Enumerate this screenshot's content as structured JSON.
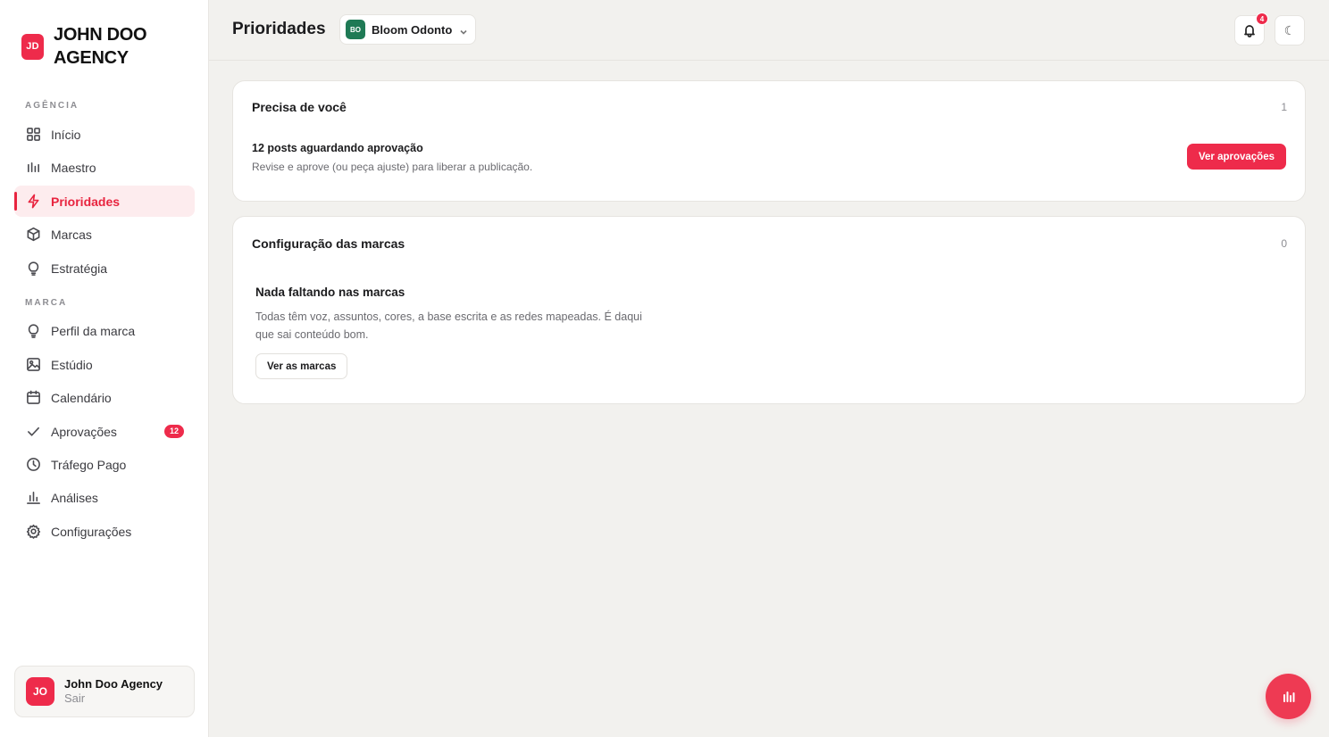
{
  "brand": {
    "logo_initials": "JD",
    "name": "JOHN DOO AGENCY"
  },
  "sidebar": {
    "sections": [
      {
        "label": "AGÊNCIA",
        "items": [
          {
            "label": "Início",
            "icon": "grid-icon"
          },
          {
            "label": "Maestro",
            "icon": "bars-icon"
          },
          {
            "label": "Prioridades",
            "icon": "bolt-icon",
            "active": true
          },
          {
            "label": "Marcas",
            "icon": "box-icon"
          },
          {
            "label": "Estratégia",
            "icon": "lightbulb-icon"
          }
        ]
      },
      {
        "label": "MARCA",
        "items": [
          {
            "label": "Perfil da marca",
            "icon": "lightbulb-icon"
          },
          {
            "label": "Estúdio",
            "icon": "image-icon"
          },
          {
            "label": "Calendário",
            "icon": "calendar-icon"
          },
          {
            "label": "Aprovações",
            "icon": "check-icon",
            "badge": "12"
          },
          {
            "label": "Tráfego Pago",
            "icon": "clock-icon"
          },
          {
            "label": "Análises",
            "icon": "chart-icon"
          },
          {
            "label": "Configurações",
            "icon": "gear-icon"
          }
        ]
      }
    ],
    "user": {
      "initials": "JO",
      "name": "John Doo Agency",
      "action": "Sair"
    }
  },
  "header": {
    "title": "Prioridades",
    "brand_selector": {
      "initials": "BO",
      "name": "Bloom Odonto"
    },
    "notifications_count": "4",
    "theme_toggle_glyph": "☾"
  },
  "cards": {
    "needs_you": {
      "title": "Precisa de você",
      "count": "1",
      "item_title": "12 posts aguardando aprovação",
      "item_desc": "Revise e aprove (ou peça ajuste) para liberar a publicação.",
      "button": "Ver aprovações"
    },
    "brand_config": {
      "title": "Configuração das marcas",
      "count": "0",
      "empty_title": "Nada faltando nas marcas",
      "empty_desc": "Todas têm voz, assuntos, cores, a base escrita e as redes mapeadas. É daqui que sai conteúdo bom.",
      "button": "Ver as marcas"
    }
  },
  "colors": {
    "accent": "#ee2b4b",
    "brand_select_avatar": "#1f7a55",
    "background": "#f2f1ee"
  }
}
